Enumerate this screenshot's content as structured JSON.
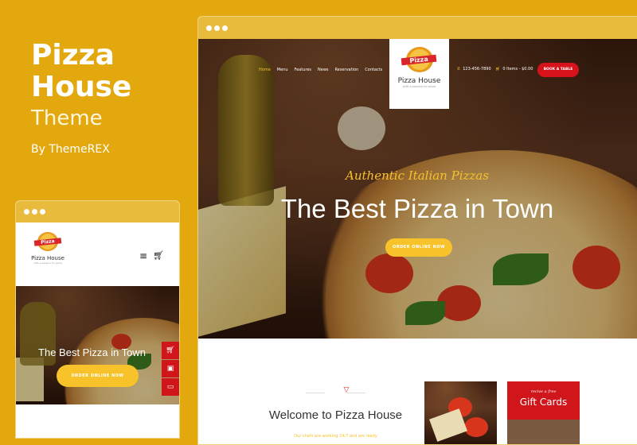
{
  "promo": {
    "title_line1": "Pizza",
    "title_line2": "House",
    "subtitle": "Theme",
    "byline": "By ThemeREX"
  },
  "colors": {
    "background": "#e3a80d",
    "accent_red": "#d8121a",
    "accent_yellow": "#f7c22a"
  },
  "desktop": {
    "nav": [
      "Home",
      "Menu",
      "Features",
      "News",
      "Reservation",
      "Contacts"
    ],
    "logo": {
      "badge": "Pizza",
      "name": "Pizza House",
      "tagline": "with a passion for pizza"
    },
    "phone": "123-456-7890",
    "cart": "0 Items - $0.00",
    "book_button": "BOOK A TABLE",
    "hero": {
      "script": "Authentic Italian Pizzas",
      "title": "The Best Pizza in Town",
      "button": "ORDER ONLINE NOW"
    },
    "welcome": {
      "title": "Welcome to Pizza House",
      "text": "Our chefs are working 24/7 and are ready"
    },
    "gift": {
      "script": "recive a free",
      "title": "Gift Cards"
    }
  },
  "mobile": {
    "logo": {
      "badge": "Pizza",
      "name": "Pizza House",
      "tagline": "with a passion for pizza"
    },
    "hero": {
      "title": "The Best Pizza in Town",
      "button": "ORDER ONLINE NOW"
    },
    "side_icons": [
      "cart-icon",
      "image-icon",
      "window-icon"
    ]
  }
}
